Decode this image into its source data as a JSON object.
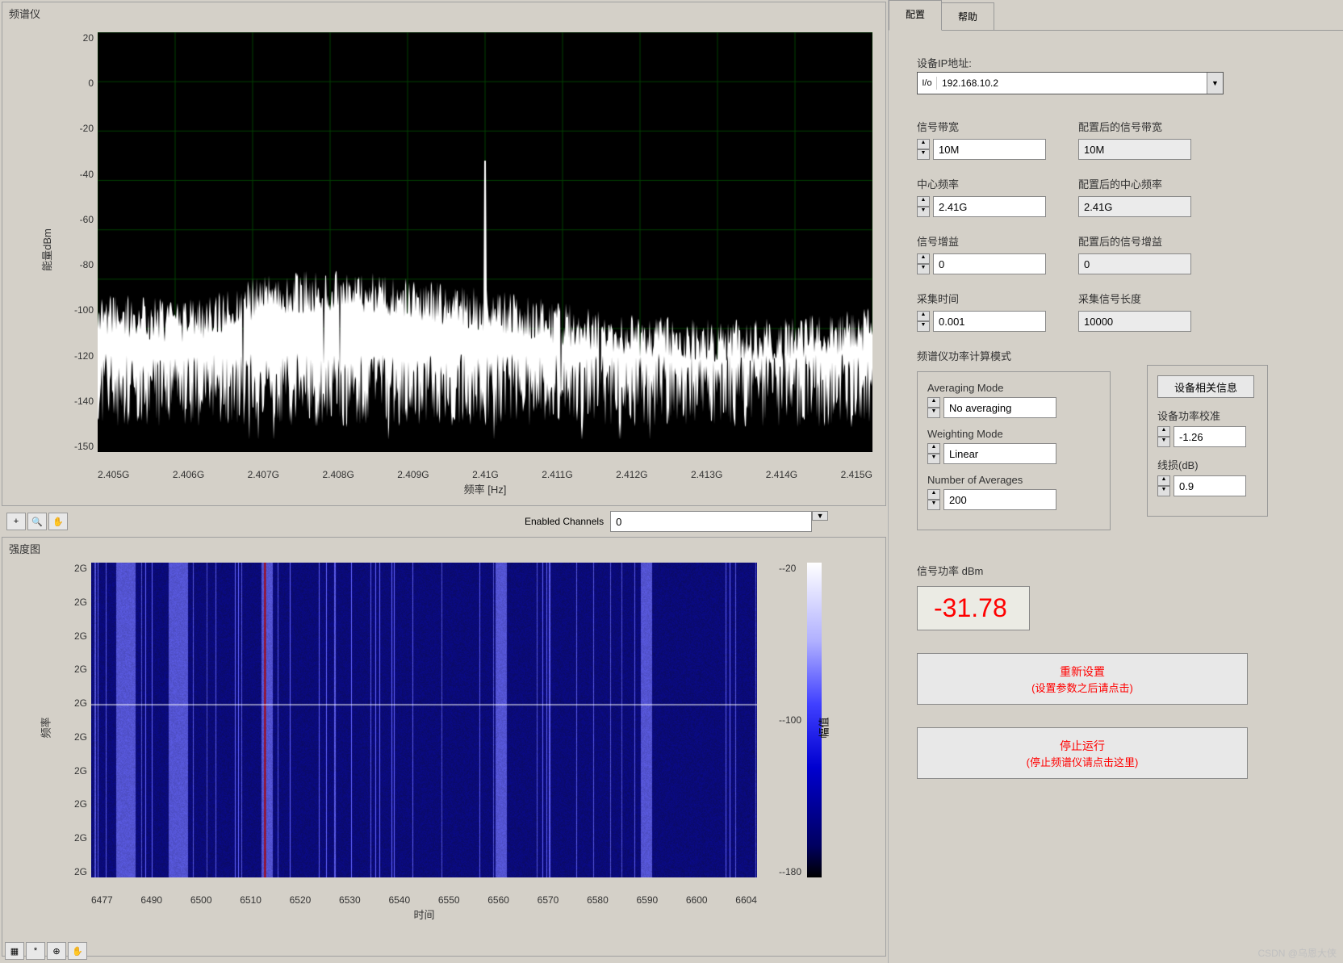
{
  "left": {
    "spectrum_title": "频谱仪",
    "spectrum": {
      "ylabel": "能量dBm",
      "xlabel": "频率 [Hz]",
      "yticks": [
        "20",
        "0",
        "-20",
        "-40",
        "-60",
        "-80",
        "-100",
        "-120",
        "-140",
        "-150"
      ],
      "xticks": [
        "2.405G",
        "2.406G",
        "2.407G",
        "2.408G",
        "2.409G",
        "2.41G",
        "2.411G",
        "2.412G",
        "2.413G",
        "2.414G",
        "2.415G"
      ]
    },
    "enabled_channels_label": "Enabled Channels",
    "enabled_channels_value": "0",
    "intensity_title": "强度图",
    "intensity": {
      "ylabel": "频率",
      "xlabel": "时间",
      "yticks": [
        "2G",
        "2G",
        "2G",
        "2G",
        "2G",
        "2G",
        "2G",
        "2G",
        "2G",
        "2G"
      ],
      "xticks": [
        "6477",
        "6490",
        "6500",
        "6510",
        "6520",
        "6530",
        "6540",
        "6550",
        "6560",
        "6570",
        "6580",
        "6590",
        "6600",
        "6604"
      ],
      "colorbar_label": "幅值",
      "colorbar_ticks": [
        "--20",
        "--100",
        "--180"
      ]
    }
  },
  "right": {
    "tabs": {
      "config": "配置",
      "help": "帮助"
    },
    "ip_label": "设备IP地址:",
    "ip_value": "192.168.10.2",
    "fields": {
      "bw_label": "信号带宽",
      "bw_value": "10M",
      "bw_after_label": "配置后的信号带宽",
      "bw_after_value": "10M",
      "cf_label": "中心频率",
      "cf_value": "2.41G",
      "cf_after_label": "配置后的中心频率",
      "cf_after_value": "2.41G",
      "gain_label": "信号增益",
      "gain_value": "0",
      "gain_after_label": "配置后的信号增益",
      "gain_after_value": "0",
      "acq_label": "采集时间",
      "acq_value": "0.001",
      "len_label": "采集信号长度",
      "len_value": "10000"
    },
    "mode_title": "频谱仪功率计算模式",
    "mode": {
      "avg_label": "Averaging Mode",
      "avg_value": "No averaging",
      "wgt_label": "Weighting Mode",
      "wgt_value": "Linear",
      "num_label": "Number of Averages",
      "num_value": "200"
    },
    "device": {
      "info_btn": "设备相关信息",
      "cal_label": "设备功率校准",
      "cal_value": "-1.26",
      "loss_label": "线损(dB)",
      "loss_value": "0.9"
    },
    "power_label": "信号功率 dBm",
    "power_value": "-31.78",
    "reset_btn": {
      "title": "重新设置",
      "sub": "(设置参数之后请点击)"
    },
    "stop_btn": {
      "title": "停止运行",
      "sub": "(停止频谱仪请点击这里)"
    }
  },
  "watermark": "CSDN @乌恩大侠",
  "chart_data": [
    {
      "type": "line",
      "title": "频谱仪",
      "xlabel": "频率 [Hz]",
      "ylabel": "能量dBm",
      "xlim": [
        "2.405G",
        "2.415G"
      ],
      "ylim": [
        -150,
        20
      ],
      "description": "Noise floor spectrum around -90 to -100 dBm with a sharp narrowband spike near 2.41G rising to approximately -32 dBm.",
      "noise_floor_dbm": -95,
      "peak": {
        "frequency": "2.41G",
        "power_dbm": -32
      }
    },
    {
      "type": "heatmap",
      "title": "强度图",
      "xlabel": "时间",
      "ylabel": "频率",
      "xlim": [
        6477,
        6604
      ],
      "colorbar_range": [
        -180,
        -20
      ],
      "description": "Spectrogram / waterfall intensity map, predominantly blue (~-100) with lighter vertical banding across the time axis."
    }
  ]
}
